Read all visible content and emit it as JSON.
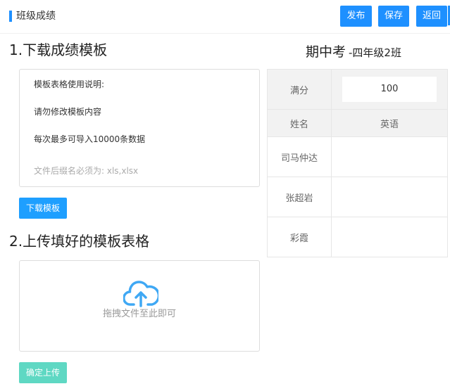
{
  "header": {
    "title": "班级成绩",
    "buttons": {
      "publish": "发布",
      "save": "保存",
      "back": "返回"
    }
  },
  "section1": {
    "title": "1.下载成绩模板",
    "info": {
      "heading": "模板表格使用说明:",
      "line1": "请勿修改模板内容",
      "line2": "每次最多可导入10000条数据",
      "note": "文件后缀名必须为: xls,xlsx"
    },
    "download_button": "下载模板"
  },
  "section2": {
    "title": "2.上传填好的模板表格",
    "drop_text": "拖拽文件至此即可",
    "confirm_button": "确定上传"
  },
  "exam": {
    "title": "期中考",
    "class": "-四年级2班",
    "full_score_label": "满分",
    "full_score_value": "100",
    "col_name": "姓名",
    "col_subject": "英语",
    "students": [
      {
        "name": "司马仲达",
        "score": ""
      },
      {
        "name": "张超岩",
        "score": ""
      },
      {
        "name": "彩霞",
        "score": ""
      }
    ]
  },
  "colors": {
    "primary": "#1e90ff",
    "confirm": "#5fd8c3",
    "cloud_icon": "#3fa8f4"
  },
  "icons": {
    "upload": "cloud-upload-icon"
  }
}
